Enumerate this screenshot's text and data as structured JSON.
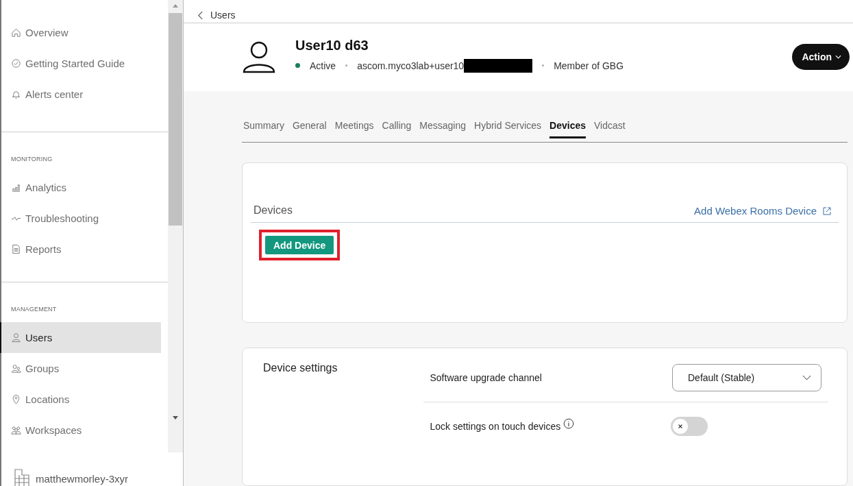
{
  "sidebar": {
    "sections": [
      {
        "items": [
          {
            "label": "Overview",
            "selected": false
          },
          {
            "label": "Getting Started Guide",
            "selected": false
          },
          {
            "label": "Alerts center",
            "selected": false
          }
        ]
      },
      {
        "heading": "MONITORING",
        "items": [
          {
            "label": "Analytics",
            "selected": false
          },
          {
            "label": "Troubleshooting",
            "selected": false
          },
          {
            "label": "Reports",
            "selected": false
          }
        ]
      },
      {
        "heading": "MANAGEMENT",
        "items": [
          {
            "label": "Users",
            "selected": true
          },
          {
            "label": "Groups",
            "selected": false
          },
          {
            "label": "Locations",
            "selected": false
          },
          {
            "label": "Workspaces",
            "selected": false
          }
        ]
      }
    ],
    "org": "matthewmorley-3xyr"
  },
  "breadcrumb": "Users",
  "user": {
    "name": "User10 d63",
    "status": "Active",
    "active": true,
    "email": "ascom.myco3lab+user10",
    "membership": "Member of GBG"
  },
  "action_button": "Action",
  "tabs": [
    {
      "label": "Summary",
      "selected": false
    },
    {
      "label": "General",
      "selected": false
    },
    {
      "label": "Meetings",
      "selected": false
    },
    {
      "label": "Calling",
      "selected": false
    },
    {
      "label": "Messaging",
      "selected": false
    },
    {
      "label": "Hybrid Services",
      "selected": false
    },
    {
      "label": "Devices",
      "selected": true
    },
    {
      "label": "Vidcast",
      "selected": false
    }
  ],
  "devices_card": {
    "title": "Devices",
    "link": "Add Webex Rooms Device",
    "button": "Add Device",
    "button_highlighted": true
  },
  "settings_card": {
    "title": "Device settings",
    "rows": [
      {
        "kind": "dropdown",
        "label": "Software upgrade channel",
        "value": "Default (Stable)"
      },
      {
        "kind": "toggle",
        "label": "Lock settings on touch devices",
        "info": true,
        "on": false
      }
    ]
  }
}
